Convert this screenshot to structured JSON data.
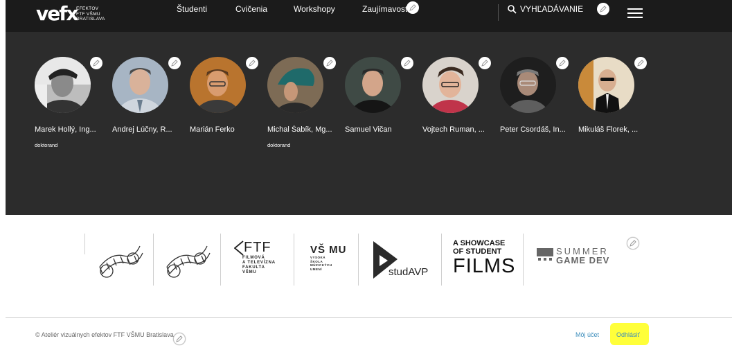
{
  "header": {
    "logo": {
      "mark": "vefx",
      "line1": "EFEKTOV",
      "line2": "FTF VŠMU",
      "line3": "BRATISLAVA"
    },
    "nav": [
      "Študenti",
      "Cvičenia",
      "Workshopy",
      "Zaujímavosti"
    ],
    "search_label": "VYHĽADÁVANIE"
  },
  "people": [
    {
      "name": "Marek Hollý, Ing...",
      "role": "doktorand"
    },
    {
      "name": "Andrej Lúčny, R...",
      "role": ""
    },
    {
      "name": "Marián Ferko",
      "role": ""
    },
    {
      "name": "Michal Šabík, Mg...",
      "role": "doktorand"
    },
    {
      "name": "Samuel Vičan",
      "role": ""
    },
    {
      "name": "Vojtech Ruman, ...",
      "role": ""
    },
    {
      "name": "Peter Csordáš, In...",
      "role": ""
    },
    {
      "name": "Mikuláš Florek, ...",
      "role": ""
    }
  ],
  "partners": {
    "ftf": {
      "mark": "FTF",
      "lines": [
        "FILMOVÁ",
        "A TELEVÍZNA",
        "FAKULTA",
        "VŠMU"
      ]
    },
    "vsmu": {
      "mark": "VŠ MU",
      "lines": [
        "VYSOKÁ",
        "ŠKOLA",
        "MÚZICKÝCH",
        "UMENÍ"
      ]
    },
    "studavp": "studAVP",
    "showcase": {
      "line1": "A SHOWCASE",
      "line2": "OF STUDENT",
      "line3": "FILMS"
    },
    "summer": {
      "line1": "SUMMER",
      "line2": "GAME DEV"
    }
  },
  "footer": {
    "copyright": "© Ateliér vizuálnych efektov FTF VŠMU Bratislava",
    "my_account": "Môj účet",
    "logout": "Odhlásiť"
  },
  "colors": {
    "dark_bg": "#2c2c2c",
    "topbar_bg": "#1b1b1b",
    "link": "#3c8dbc",
    "highlight": "#ffff3a"
  }
}
